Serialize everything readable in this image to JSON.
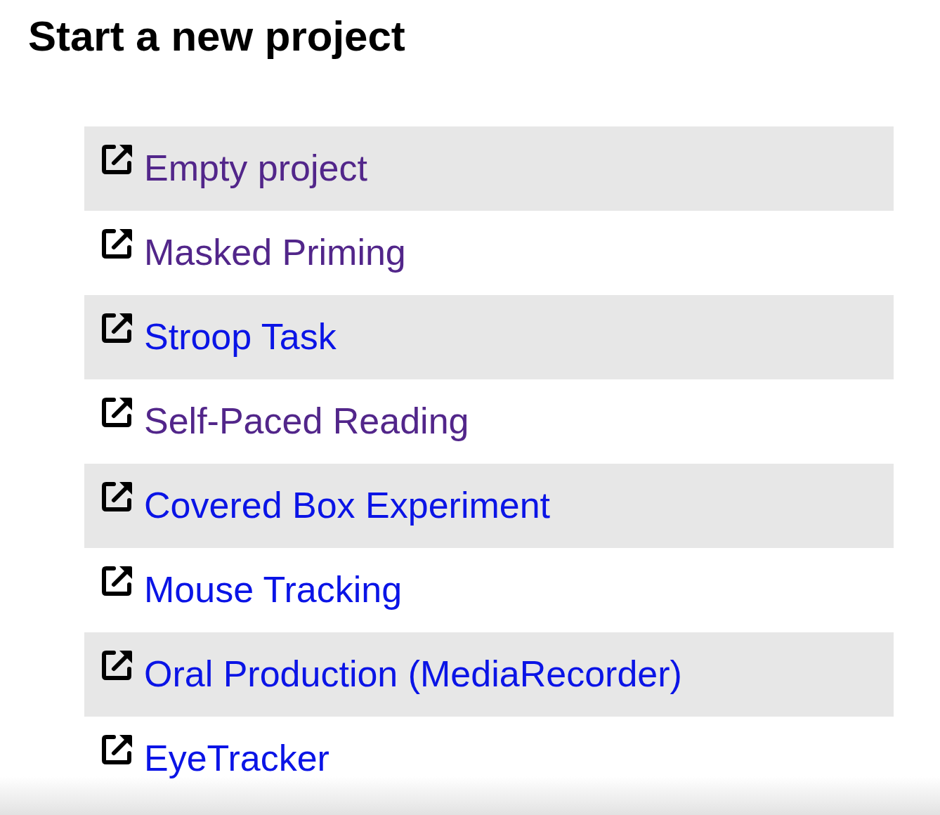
{
  "title": "Start a new project",
  "projects": [
    {
      "label": "Empty project",
      "visited": true
    },
    {
      "label": "Masked Priming",
      "visited": true
    },
    {
      "label": "Stroop Task",
      "visited": false
    },
    {
      "label": "Self-Paced Reading",
      "visited": true
    },
    {
      "label": "Covered Box Experiment",
      "visited": false
    },
    {
      "label": "Mouse Tracking",
      "visited": false
    },
    {
      "label": "Oral Production (MediaRecorder)",
      "visited": false
    },
    {
      "label": "EyeTracker",
      "visited": false
    }
  ]
}
